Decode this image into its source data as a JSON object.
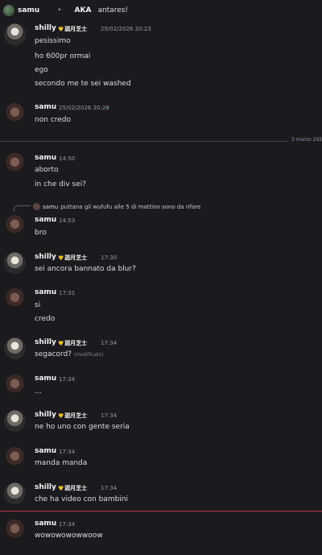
{
  "topbar": {
    "username": "samu",
    "separator": "•",
    "aka_label": "AKA",
    "aka_value": "antares!"
  },
  "date_divider": "3 marzo 202",
  "reply_preview": {
    "author": "samu",
    "text": "puttana gli wufufu alle 5 di mattino sono da rifare"
  },
  "badge_tag": "迦月芝士",
  "edited_label": "(modificato)",
  "messages": [
    {
      "author": "shilly",
      "time": "25/02/2026 20:23",
      "lines": [
        "pesissimo",
        "ho 600pr ormai",
        "ego",
        "secondo me te sei washed"
      ]
    },
    {
      "author": "samu",
      "time": "25/02/2026 20:28",
      "lines": [
        "non credo"
      ]
    },
    {
      "author": "samu",
      "time": "14:50",
      "lines": [
        "aborto",
        "in che div sei?"
      ]
    },
    {
      "author": "samu",
      "time": "14:53",
      "lines": [
        "bro"
      ]
    },
    {
      "author": "shilly",
      "time": "17:30",
      "lines": [
        "sei ancora bannato da blur?"
      ]
    },
    {
      "author": "samu",
      "time": "17:31",
      "lines": [
        "si",
        "credo"
      ]
    },
    {
      "author": "shilly",
      "time": "17:34",
      "lines": [
        "segacord?"
      ]
    },
    {
      "author": "samu",
      "time": "17:34",
      "lines": [
        "..."
      ]
    },
    {
      "author": "shilly",
      "time": "17:34",
      "lines": [
        "ne ho uno con gente seria"
      ]
    },
    {
      "author": "samu",
      "time": "17:34",
      "lines": [
        "manda manda"
      ]
    },
    {
      "author": "shilly",
      "time": "17:34",
      "lines": [
        "che ha video con bambini"
      ]
    },
    {
      "author": "samu",
      "time": "17:34",
      "lines": [
        "wowowowowwoow"
      ]
    }
  ]
}
